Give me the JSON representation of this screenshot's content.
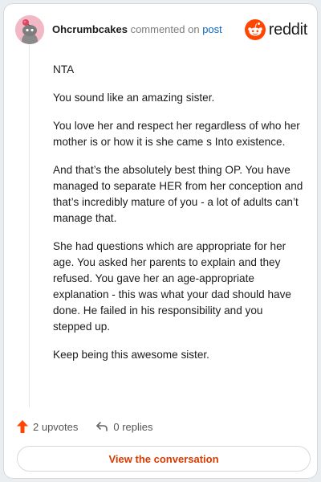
{
  "header": {
    "username": "Ohcrumbcakes",
    "action_text": "commented on",
    "post_link": "post",
    "brand_name": "reddit"
  },
  "comment": {
    "paragraphs": [
      "NTA",
      "You sound like an amazing sister.",
      "You love her and respect her regardless of who her mother is or how it is she came s Into existence.",
      "And that’s the absolutely best thing OP. You have managed to separate HER from her conception and that’s incredibly mature of you - a lot of adults can’t manage that.",
      "She had questions which are appropriate for her age. You asked her parents to explain and they refused. You gave her an age-appropriate explanation - this was what your dad should have done. He failed in his responsibility and you stepped up.",
      "Keep being this awesome sister."
    ]
  },
  "actions": {
    "upvotes": "2 upvotes",
    "replies": "0 replies",
    "view_button": "View the conversation"
  },
  "icons": {
    "avatar": "snoo-avatar-icon",
    "brand": "reddit-logo-icon",
    "upvote": "upvote-arrow-icon",
    "reply": "reply-arrow-icon"
  },
  "colors": {
    "brand_orange": "#ff4500",
    "link_blue": "#0a66c2",
    "button_text": "#d93a00"
  }
}
